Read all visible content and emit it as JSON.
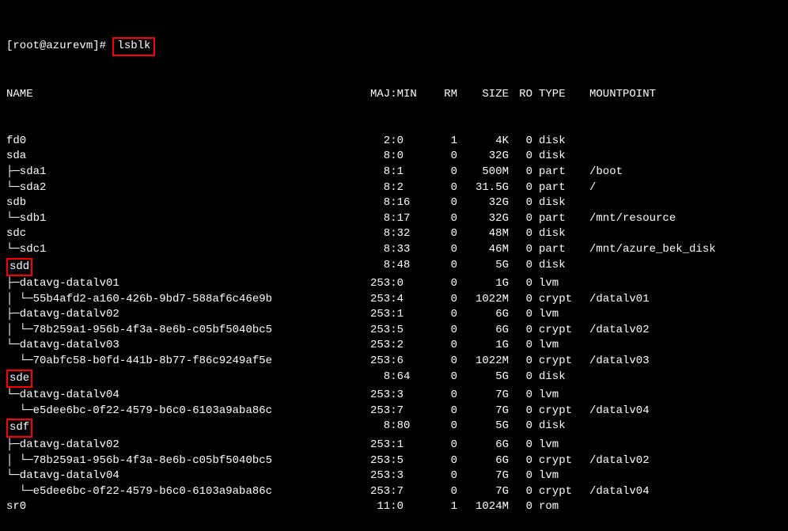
{
  "prompt": "[root@azurevm]# ",
  "command": "lsblk",
  "headers": {
    "name": "NAME",
    "majmin": "MAJ:MIN",
    "rm": "RM",
    "size": "SIZE",
    "ro": "RO",
    "type": "TYPE",
    "mountpoint": "MOUNTPOINT"
  },
  "rows": [
    {
      "name": "fd0",
      "indent": 0,
      "tree": "",
      "majmin": "  2:0",
      "rm": "1",
      "size": "4K",
      "ro": "0",
      "type": "disk",
      "mount": "",
      "highlight": false
    },
    {
      "name": "sda",
      "indent": 0,
      "tree": "",
      "majmin": "  8:0",
      "rm": "0",
      "size": "32G",
      "ro": "0",
      "type": "disk",
      "mount": "",
      "highlight": false
    },
    {
      "name": "sda1",
      "indent": 1,
      "tree": "├─",
      "majmin": "  8:1",
      "rm": "0",
      "size": "500M",
      "ro": "0",
      "type": "part",
      "mount": "/boot",
      "highlight": false
    },
    {
      "name": "sda2",
      "indent": 1,
      "tree": "└─",
      "majmin": "  8:2",
      "rm": "0",
      "size": "31.5G",
      "ro": "0",
      "type": "part",
      "mount": "/",
      "highlight": false
    },
    {
      "name": "sdb",
      "indent": 0,
      "tree": "",
      "majmin": "  8:16",
      "rm": "0",
      "size": "32G",
      "ro": "0",
      "type": "disk",
      "mount": "",
      "highlight": false
    },
    {
      "name": "sdb1",
      "indent": 1,
      "tree": "└─",
      "majmin": "  8:17",
      "rm": "0",
      "size": "32G",
      "ro": "0",
      "type": "part",
      "mount": "/mnt/resource",
      "highlight": false
    },
    {
      "name": "sdc",
      "indent": 0,
      "tree": "",
      "majmin": "  8:32",
      "rm": "0",
      "size": "48M",
      "ro": "0",
      "type": "disk",
      "mount": "",
      "highlight": false
    },
    {
      "name": "sdc1",
      "indent": 1,
      "tree": "└─",
      "majmin": "  8:33",
      "rm": "0",
      "size": "46M",
      "ro": "0",
      "type": "part",
      "mount": "/mnt/azure_bek_disk",
      "highlight": false
    },
    {
      "name": "sdd",
      "indent": 0,
      "tree": "",
      "majmin": "  8:48",
      "rm": "0",
      "size": "5G",
      "ro": "0",
      "type": "disk",
      "mount": "",
      "highlight": true
    },
    {
      "name": "datavg-datalv01",
      "indent": 1,
      "tree": "├─",
      "majmin": "253:0",
      "rm": "0",
      "size": "1G",
      "ro": "0",
      "type": "lvm",
      "mount": "",
      "highlight": false
    },
    {
      "name": "55b4afd2-a160-426b-9bd7-588af6c46e9b",
      "indent": 2,
      "tree": "│ └─",
      "majmin": "253:4",
      "rm": "0",
      "size": "1022M",
      "ro": "0",
      "type": "crypt",
      "mount": "/datalv01",
      "highlight": false
    },
    {
      "name": "datavg-datalv02",
      "indent": 1,
      "tree": "├─",
      "majmin": "253:1",
      "rm": "0",
      "size": "6G",
      "ro": "0",
      "type": "lvm",
      "mount": "",
      "highlight": false
    },
    {
      "name": "78b259a1-956b-4f3a-8e6b-c05bf5040bc5",
      "indent": 2,
      "tree": "│ └─",
      "majmin": "253:5",
      "rm": "0",
      "size": "6G",
      "ro": "0",
      "type": "crypt",
      "mount": "/datalv02",
      "highlight": false
    },
    {
      "name": "datavg-datalv03",
      "indent": 1,
      "tree": "└─",
      "majmin": "253:2",
      "rm": "0",
      "size": "1G",
      "ro": "0",
      "type": "lvm",
      "mount": "",
      "highlight": false
    },
    {
      "name": "70abfc58-b0fd-441b-8b77-f86c9249af5e",
      "indent": 2,
      "tree": "  └─",
      "majmin": "253:6",
      "rm": "0",
      "size": "1022M",
      "ro": "0",
      "type": "crypt",
      "mount": "/datalv03",
      "highlight": false
    },
    {
      "name": "sde",
      "indent": 0,
      "tree": "",
      "majmin": "  8:64",
      "rm": "0",
      "size": "5G",
      "ro": "0",
      "type": "disk",
      "mount": "",
      "highlight": true
    },
    {
      "name": "datavg-datalv04",
      "indent": 1,
      "tree": "└─",
      "majmin": "253:3",
      "rm": "0",
      "size": "7G",
      "ro": "0",
      "type": "lvm",
      "mount": "",
      "highlight": false
    },
    {
      "name": "e5dee6bc-0f22-4579-b6c0-6103a9aba86c",
      "indent": 2,
      "tree": "  └─",
      "majmin": "253:7",
      "rm": "0",
      "size": "7G",
      "ro": "0",
      "type": "crypt",
      "mount": "/datalv04",
      "highlight": false
    },
    {
      "name": "sdf",
      "indent": 0,
      "tree": "",
      "majmin": "  8:80",
      "rm": "0",
      "size": "5G",
      "ro": "0",
      "type": "disk",
      "mount": "",
      "highlight": true
    },
    {
      "name": "datavg-datalv02",
      "indent": 1,
      "tree": "├─",
      "majmin": "253:1",
      "rm": "0",
      "size": "6G",
      "ro": "0",
      "type": "lvm",
      "mount": "",
      "highlight": false
    },
    {
      "name": "78b259a1-956b-4f3a-8e6b-c05bf5040bc5",
      "indent": 2,
      "tree": "│ └─",
      "majmin": "253:5",
      "rm": "0",
      "size": "6G",
      "ro": "0",
      "type": "crypt",
      "mount": "/datalv02",
      "highlight": false
    },
    {
      "name": "datavg-datalv04",
      "indent": 1,
      "tree": "└─",
      "majmin": "253:3",
      "rm": "0",
      "size": "7G",
      "ro": "0",
      "type": "lvm",
      "mount": "",
      "highlight": false
    },
    {
      "name": "e5dee6bc-0f22-4579-b6c0-6103a9aba86c",
      "indent": 2,
      "tree": "  └─",
      "majmin": "253:7",
      "rm": "0",
      "size": "7G",
      "ro": "0",
      "type": "crypt",
      "mount": "/datalv04",
      "highlight": false
    },
    {
      "name": "sr0",
      "indent": 0,
      "tree": "",
      "majmin": " 11:0",
      "rm": "1",
      "size": "1024M",
      "ro": "0",
      "type": "rom",
      "mount": "",
      "highlight": false
    }
  ]
}
